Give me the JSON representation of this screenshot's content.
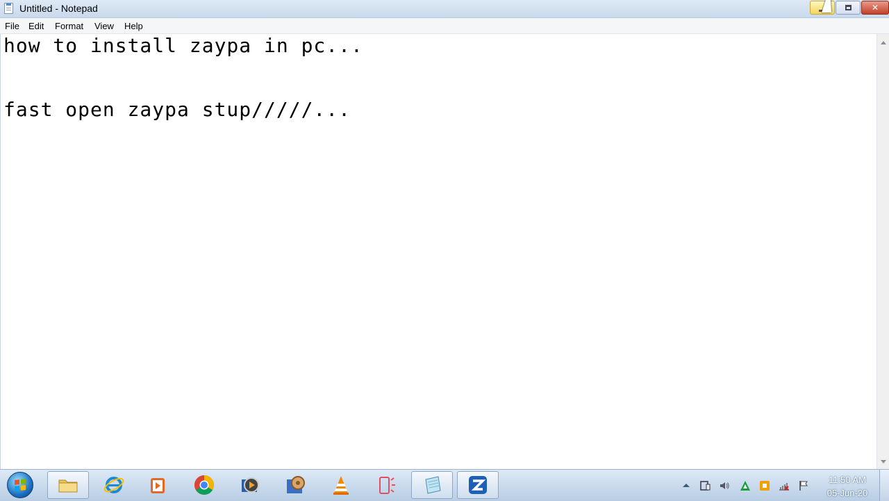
{
  "window": {
    "title": "Untitled - Notepad",
    "close_glyph": "✕"
  },
  "menu": [
    {
      "label": "File"
    },
    {
      "label": "Edit"
    },
    {
      "label": "Format"
    },
    {
      "label": "View"
    },
    {
      "label": "Help"
    }
  ],
  "editor": {
    "lines": [
      "how to install zaypa in pc...",
      "",
      "fast open zaypa stup/////..."
    ]
  },
  "taskbar": {
    "pinned": [
      {
        "icon": "folder-icon"
      },
      {
        "icon": "internet-explorer-icon"
      },
      {
        "icon": "media-player-icon"
      },
      {
        "icon": "chrome-icon"
      },
      {
        "icon": "media-app-icon"
      },
      {
        "icon": "photo-app-icon"
      },
      {
        "icon": "vlc-icon"
      },
      {
        "icon": "phone-app-icon"
      },
      {
        "icon": "notepad-icon"
      },
      {
        "icon": "zapya-icon"
      }
    ],
    "tray": [
      "show-hidden-icons-icon",
      "device-icon",
      "volume-icon",
      "green-app-icon",
      "security-icon",
      "network-icon",
      "action-center-flag-icon"
    ],
    "clock_time": "11:50 AM",
    "clock_date": "05-Jun-20"
  }
}
